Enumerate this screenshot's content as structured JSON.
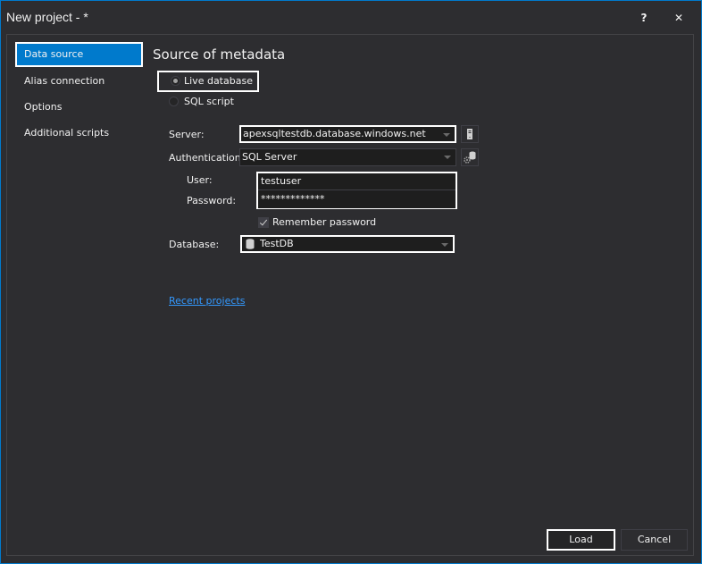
{
  "window": {
    "title": "New project - *",
    "help_label": "?",
    "close_label": "✕"
  },
  "sidebar": {
    "items": [
      {
        "label": "Data source",
        "active": true
      },
      {
        "label": "Alias connection",
        "active": false
      },
      {
        "label": "Options",
        "active": false
      },
      {
        "label": "Additional scripts",
        "active": false
      }
    ]
  },
  "main": {
    "heading": "Source of metadata",
    "source_options": [
      {
        "label": "Live database",
        "checked": true
      },
      {
        "label": "SQL script",
        "checked": false
      }
    ],
    "server": {
      "label": "Server:",
      "value": "apexsqltestdb.database.windows.net"
    },
    "authentication": {
      "label": "Authentication:",
      "value": "SQL Server"
    },
    "user": {
      "label": "User:",
      "value": "testuser"
    },
    "password": {
      "label": "Password:",
      "value": "*************"
    },
    "remember_password": {
      "label": "Remember password",
      "checked": true
    },
    "database": {
      "label": "Database:",
      "value": "TestDB"
    },
    "recent_projects_link": "Recent projects"
  },
  "footer": {
    "load_label": "Load",
    "cancel_label": "Cancel"
  },
  "colors": {
    "accent": "#007acc",
    "background": "#2d2d30",
    "link": "#3399ff"
  }
}
